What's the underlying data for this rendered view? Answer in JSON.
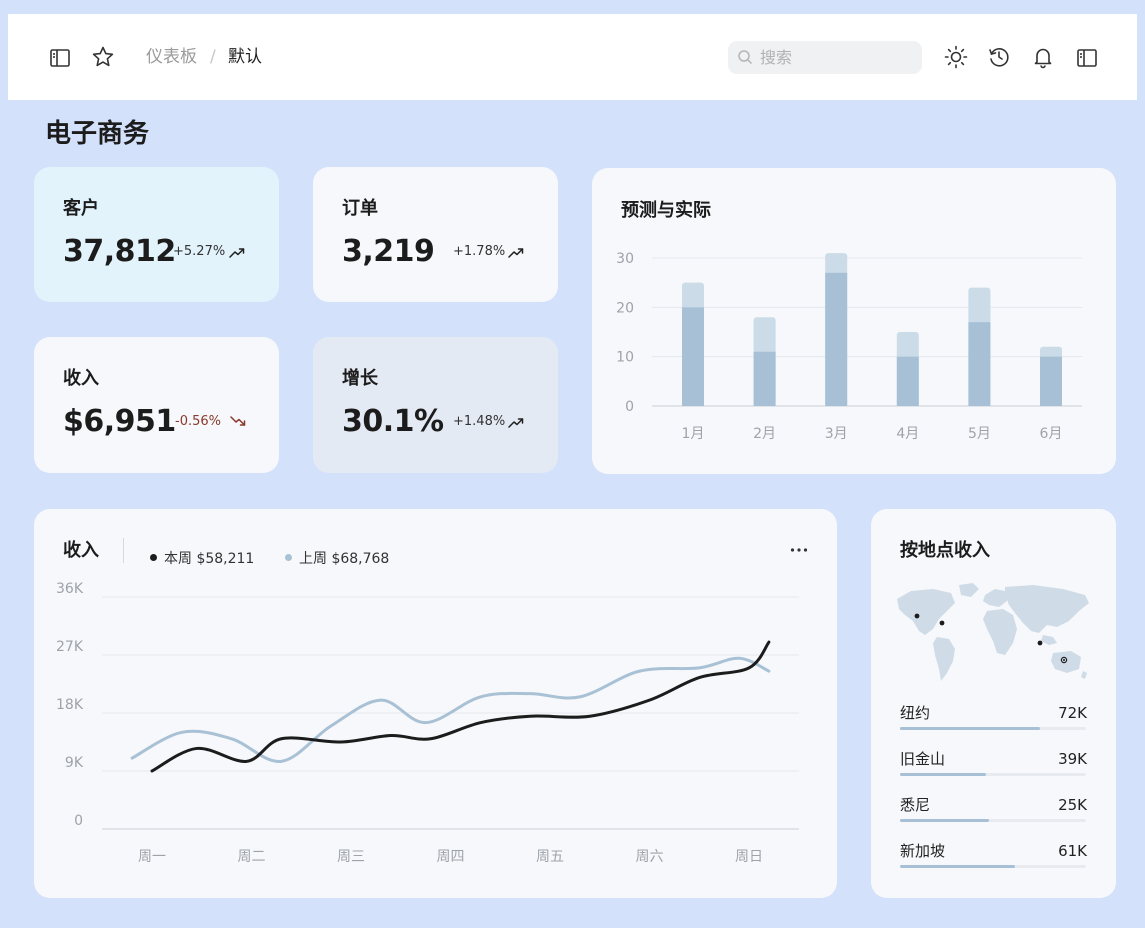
{
  "header": {
    "breadcrumb_root": "仪表板",
    "breadcrumb_sep": "/",
    "breadcrumb_current": "默认",
    "search_placeholder": "搜索",
    "icons": [
      "sidebar-toggle-icon",
      "star-icon",
      "search-icon",
      "sun-icon",
      "history-icon",
      "bell-icon",
      "panel-toggle-icon"
    ]
  },
  "page_title": "电子商务",
  "kpis": [
    {
      "label": "客户",
      "value": "37,812",
      "change": "+5.27%",
      "trend": "up"
    },
    {
      "label": "订单",
      "value": "3,219",
      "change": "+1.78%",
      "trend": "up"
    },
    {
      "label": "收入",
      "value": "$6,951",
      "change": "-0.56%",
      "trend": "down"
    },
    {
      "label": "增长",
      "value": "30.1%",
      "change": "+1.48%",
      "trend": "up"
    }
  ],
  "colors": {
    "background": "#d3e1fb",
    "card": "#f6f8fb",
    "card_customers": "#e3f3fc",
    "card_growth": "#e4eaf4",
    "bar_actual": "#a7c0d6",
    "bar_projection": "#cbdbe8",
    "line_this_week": "#1c1c1c",
    "line_last_week": "#a9c1d5",
    "negative": "#8a3a2a"
  },
  "chart_data": [
    {
      "type": "bar",
      "title": "预测与实际",
      "categories": [
        "1月",
        "2月",
        "3月",
        "4月",
        "5月",
        "6月"
      ],
      "yticks": [
        "0",
        "10",
        "20",
        "30"
      ],
      "ylim": [
        0,
        30
      ],
      "grid": true,
      "series": [
        {
          "values": [
            20,
            11,
            27,
            10,
            17,
            10
          ]
        },
        {
          "values": [
            25,
            18,
            31,
            15,
            24,
            12
          ]
        }
      ]
    },
    {
      "type": "line",
      "title": "收入",
      "categories": [
        "周一",
        "周二",
        "周三",
        "周四",
        "周五",
        "周六",
        "周日"
      ],
      "yticks": [
        "0",
        "9K",
        "18K",
        "27K",
        "36K"
      ],
      "ylim": [
        0,
        36000
      ],
      "grid": true,
      "legend": [
        {
          "label": "本周 $58,211",
          "color": "#1c1c1c"
        },
        {
          "label": "上周 $68,768",
          "color": "#a9c1d5"
        }
      ],
      "series": [
        {
          "x": [
            0,
            0.45,
            0.95,
            1.3,
            1.9,
            2.4,
            2.8,
            3.3,
            3.8,
            4.4,
            5.0,
            5.5,
            6.0,
            6.2
          ],
          "values": [
            9000,
            12500,
            10500,
            14000,
            13500,
            14500,
            14000,
            16500,
            17500,
            17500,
            20000,
            23500,
            25000,
            29000
          ]
        },
        {
          "x": [
            -0.2,
            0.3,
            0.8,
            1.3,
            1.8,
            2.3,
            2.75,
            3.3,
            3.8,
            4.3,
            4.9,
            5.5,
            5.9,
            6.2
          ],
          "values": [
            11000,
            15000,
            14000,
            10500,
            16000,
            20000,
            16500,
            20500,
            21000,
            20500,
            24500,
            25000,
            26500,
            24500
          ]
        }
      ]
    }
  ],
  "line_card": {
    "more_icon": "more-horizontal-icon"
  },
  "locations": {
    "title": "按地点收入",
    "map_icon": "world-map",
    "items": [
      {
        "name": "纽约",
        "value": "72K",
        "share": 0.75
      },
      {
        "name": "旧金山",
        "value": "39K",
        "share": 0.46
      },
      {
        "name": "悉尼",
        "value": "25K",
        "share": 0.48
      },
      {
        "name": "新加坡",
        "value": "61K",
        "share": 0.62
      }
    ]
  }
}
